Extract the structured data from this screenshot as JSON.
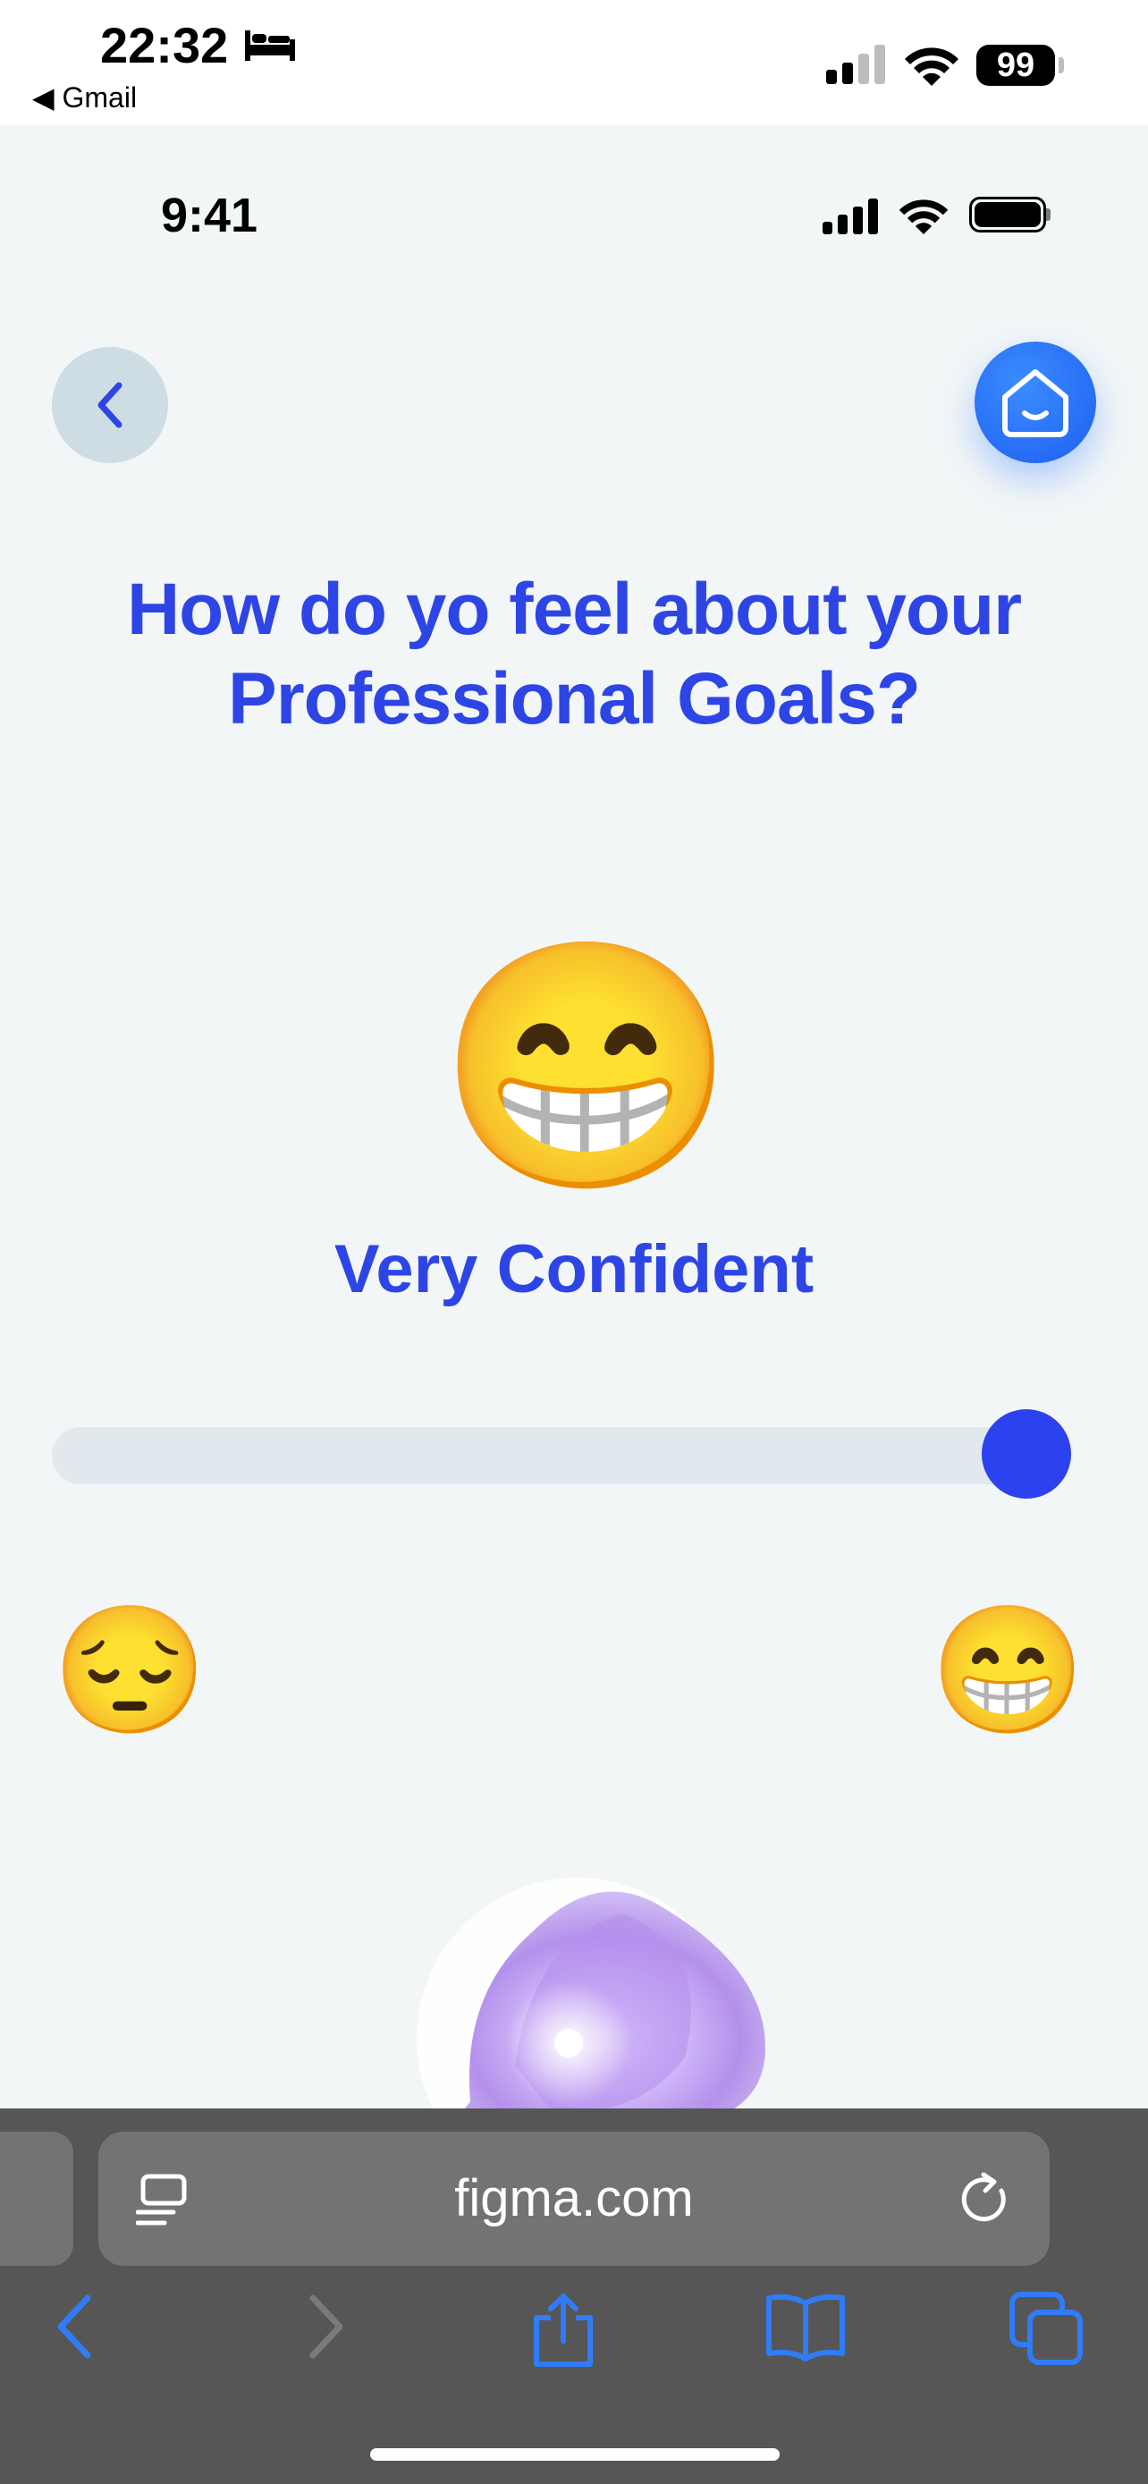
{
  "system_status": {
    "time": "22:32",
    "back_app": "◀ Gmail",
    "battery": "99"
  },
  "prototype_status": {
    "time": "9:41"
  },
  "question": "How do yo feel about your Professional Goals?",
  "selected_mood": {
    "emoji": "😁",
    "label": "Very Confident"
  },
  "slider": {
    "value": 1.0,
    "min_emoji": "😔",
    "max_emoji": "😁"
  },
  "browser": {
    "url": "figma.com"
  },
  "colors": {
    "accent": "#2e45e6",
    "background": "#f2f6f7",
    "home_button": "#1d5ff0"
  }
}
